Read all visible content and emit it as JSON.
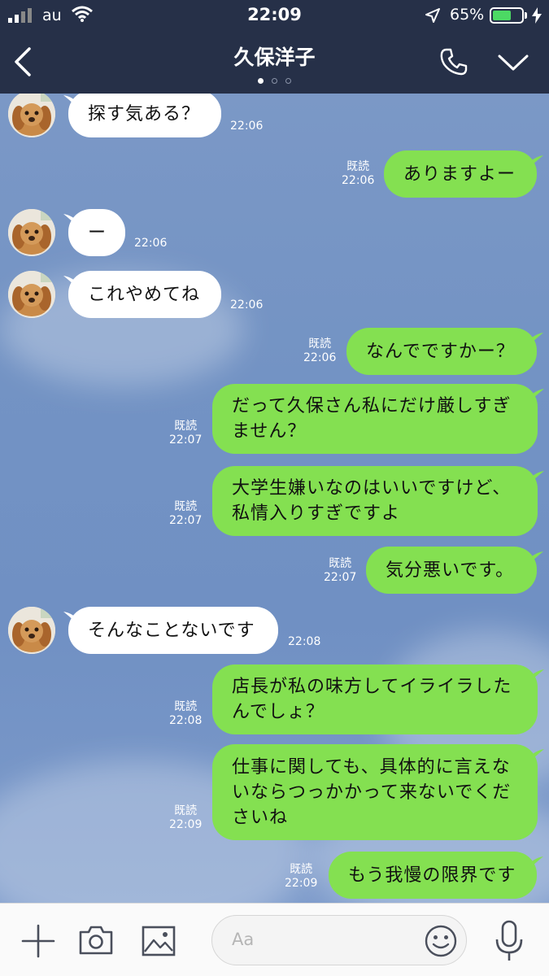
{
  "status_bar": {
    "carrier": "au",
    "time": "22:09",
    "battery_percent_text": "65%",
    "battery_level": 0.65,
    "battery_color": "#4cd964"
  },
  "header": {
    "title": "久保洋子",
    "page_count": 3,
    "active_page": 1,
    "icons": [
      "back-chevron-icon",
      "phone-icon",
      "chevron-down-icon"
    ]
  },
  "messages": [
    {
      "side": "in",
      "text": "探す気ある？",
      "time": "22:06"
    },
    {
      "side": "out",
      "text": "ありますよー",
      "read": "既読",
      "time": "22:06"
    },
    {
      "side": "in",
      "text": "ー",
      "time": "22:06"
    },
    {
      "side": "in",
      "text": "これやめてね",
      "time": "22:06"
    },
    {
      "side": "out",
      "text": "なんでですかー？",
      "read": "既読",
      "time": "22:06"
    },
    {
      "side": "out",
      "lines": [
        "だって久保さん私にだけ厳しすぎ",
        "ません？"
      ],
      "read": "既読",
      "time": "22:07"
    },
    {
      "side": "out",
      "lines": [
        "大学生嫌いなのはいいですけど、",
        "私情入りすぎですよ"
      ],
      "read": "既読",
      "time": "22:07"
    },
    {
      "side": "out",
      "text": "気分悪いです。",
      "read": "既読",
      "time": "22:07"
    },
    {
      "side": "in",
      "text": "そんなことないです",
      "time": "22:08"
    },
    {
      "side": "out",
      "lines": [
        "店長が私の味方してイライラした",
        "んでしょ？"
      ],
      "read": "既読",
      "time": "22:08"
    },
    {
      "side": "out",
      "lines": [
        "仕事に関しても、具体的に言えな",
        "いならつっかかって来ないでくだ",
        "さいね"
      ],
      "read": "既読",
      "time": "22:09"
    },
    {
      "side": "out",
      "text": "もう我慢の限界です",
      "read": "既読",
      "time": "22:09"
    }
  ],
  "input_bar": {
    "placeholder": "Aa",
    "icons": [
      "plus-icon",
      "camera-icon",
      "image-icon",
      "emoji-icon",
      "microphone-icon"
    ]
  },
  "colors": {
    "header_bg": "#263048",
    "bubble_out": "#84e051",
    "bubble_in": "#ffffff",
    "chat_bg": "#7393c4"
  }
}
